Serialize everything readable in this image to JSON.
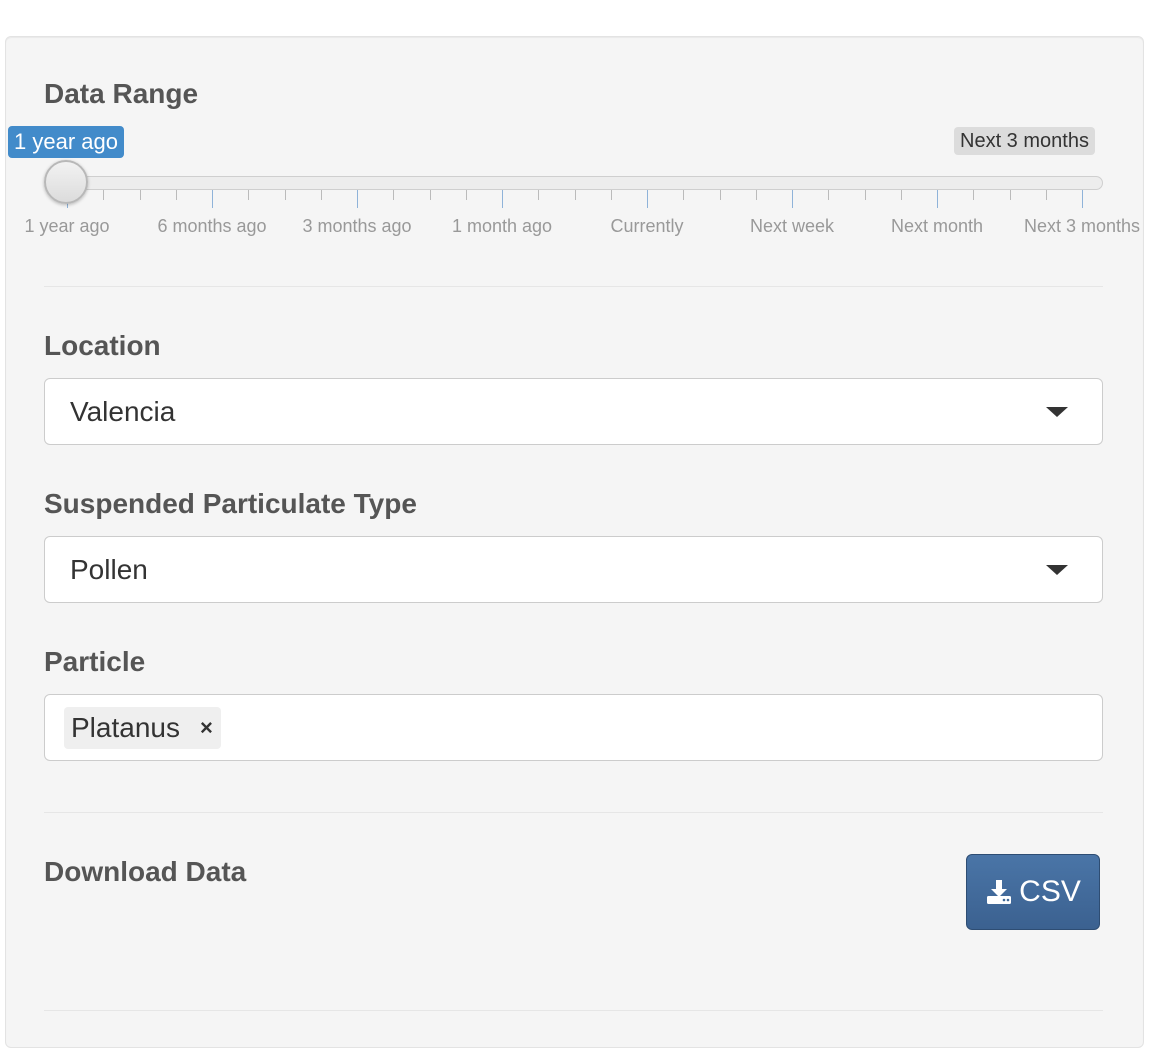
{
  "data_range": {
    "label": "Data Range",
    "from_value": "1 year ago",
    "to_value": "Next 3 months",
    "grid_labels": [
      "1 year ago",
      "6 months ago",
      "3 months ago",
      "1 month ago",
      "Currently",
      "Next week",
      "Next month",
      "Next 3 months"
    ],
    "selected_from_index": 0,
    "selected_to_index": 7
  },
  "location": {
    "label": "Location",
    "value": "Valencia"
  },
  "particulate_type": {
    "label": "Suspended Particulate Type",
    "value": "Pollen"
  },
  "particle": {
    "label": "Particle",
    "tokens": [
      "Platanus"
    ],
    "remove_glyph": "×"
  },
  "download": {
    "label": "Download Data",
    "button_label": "CSV",
    "button_icon": "download-icon"
  },
  "colors": {
    "accent": "#428bca",
    "button": "#3f6897",
    "panel_bg": "#f5f5f5"
  }
}
